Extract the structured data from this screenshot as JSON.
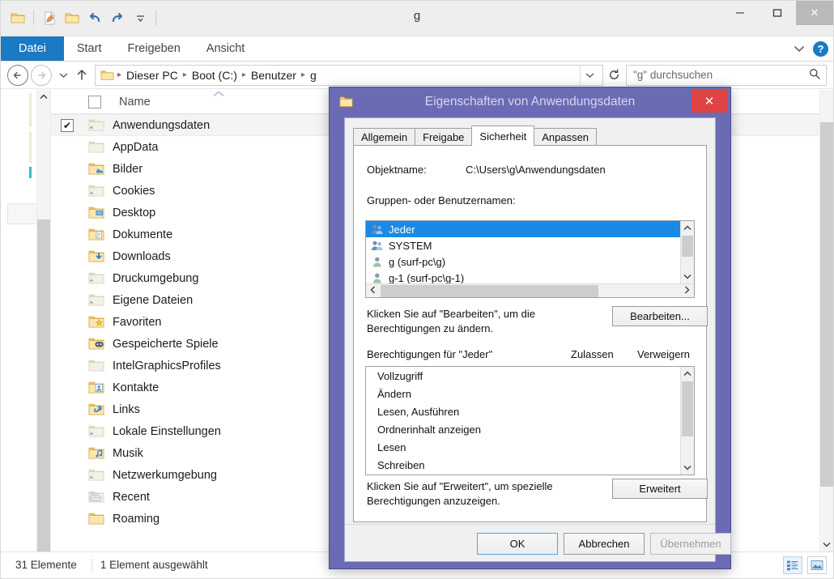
{
  "window": {
    "title": "g",
    "minimize_label": "–",
    "maximize_label": "❑",
    "close_label": "✕"
  },
  "quick_access": {
    "items": [
      {
        "name": "folder-icon",
        "label": ""
      },
      {
        "name": "new-document-icon",
        "label": ""
      },
      {
        "name": "new-folder-icon",
        "label": ""
      },
      {
        "name": "undo-icon",
        "label": "↶"
      },
      {
        "name": "redo-icon",
        "label": "↷"
      },
      {
        "name": "customize-qat-icon",
        "label": "▾"
      }
    ]
  },
  "ribbon": {
    "tabs": [
      {
        "label": "Datei",
        "active": true
      },
      {
        "label": "Start",
        "active": false
      },
      {
        "label": "Freigeben",
        "active": false
      },
      {
        "label": "Ansicht",
        "active": false
      }
    ],
    "expand_icon": "⌄",
    "help_icon": "?"
  },
  "address": {
    "back_icon": "←",
    "forward_icon": "→",
    "recent_icon": "▾",
    "up_icon": "↑",
    "breadcrumbs": [
      "Dieser PC",
      "Boot (C:)",
      "Benutzer",
      "g"
    ],
    "separator": "▸",
    "dropdown_icon": "⌄",
    "refresh_icon": "⟳",
    "search_placeholder": "\"g\" durchsuchen",
    "search_value": "",
    "search_icon": "⚲"
  },
  "column_header": {
    "name_label": "Name",
    "sort_indicator": "▴"
  },
  "file_list": {
    "items": [
      {
        "label": "Anwendungsdaten",
        "icon": "folder-junction-icon",
        "selected": true,
        "checked": true,
        "style": "pale"
      },
      {
        "label": "AppData",
        "icon": "folder-icon",
        "selected": false,
        "checked": false,
        "style": "pale"
      },
      {
        "label": "Bilder",
        "icon": "folder-pictures-icon",
        "selected": false,
        "checked": false,
        "style": "normal"
      },
      {
        "label": "Cookies",
        "icon": "folder-junction-icon",
        "selected": false,
        "checked": false,
        "style": "pale"
      },
      {
        "label": "Desktop",
        "icon": "folder-desktop-icon",
        "selected": false,
        "checked": false,
        "style": "normal"
      },
      {
        "label": "Dokumente",
        "icon": "folder-documents-icon",
        "selected": false,
        "checked": false,
        "style": "normal"
      },
      {
        "label": "Downloads",
        "icon": "folder-downloads-icon",
        "selected": false,
        "checked": false,
        "style": "normal"
      },
      {
        "label": "Druckumgebung",
        "icon": "folder-junction-icon",
        "selected": false,
        "checked": false,
        "style": "pale"
      },
      {
        "label": "Eigene Dateien",
        "icon": "folder-junction-icon",
        "selected": false,
        "checked": false,
        "style": "pale"
      },
      {
        "label": "Favoriten",
        "icon": "folder-favorites-icon",
        "selected": false,
        "checked": false,
        "style": "normal"
      },
      {
        "label": "Gespeicherte Spiele",
        "icon": "folder-savedgames-icon",
        "selected": false,
        "checked": false,
        "style": "normal"
      },
      {
        "label": "IntelGraphicsProfiles",
        "icon": "folder-icon",
        "selected": false,
        "checked": false,
        "style": "pale"
      },
      {
        "label": "Kontakte",
        "icon": "folder-contacts-icon",
        "selected": false,
        "checked": false,
        "style": "normal"
      },
      {
        "label": "Links",
        "icon": "folder-links-icon",
        "selected": false,
        "checked": false,
        "style": "normal"
      },
      {
        "label": "Lokale Einstellungen",
        "icon": "folder-junction-icon",
        "selected": false,
        "checked": false,
        "style": "pale"
      },
      {
        "label": "Musik",
        "icon": "folder-music-icon",
        "selected": false,
        "checked": false,
        "style": "normal"
      },
      {
        "label": "Netzwerkumgebung",
        "icon": "folder-junction-icon",
        "selected": false,
        "checked": false,
        "style": "pale"
      },
      {
        "label": "Recent",
        "icon": "folder-recent-icon",
        "selected": false,
        "checked": false,
        "style": "pale"
      },
      {
        "label": "Roaming",
        "icon": "folder-icon",
        "selected": false,
        "checked": false,
        "style": "normal"
      }
    ]
  },
  "status_bar": {
    "item_count": "31 Elemente",
    "selection": "1 Element ausgewählt",
    "view_details_icon": "details-view-icon",
    "view_thumbs_icon": "thumbnail-view-icon"
  },
  "dialog": {
    "title": "Eigenschaften von Anwendungsdaten",
    "icon": "folder-icon",
    "close_label": "✕",
    "tabs": [
      {
        "label": "Allgemein",
        "active": false
      },
      {
        "label": "Freigabe",
        "active": false
      },
      {
        "label": "Sicherheit",
        "active": true
      },
      {
        "label": "Anpassen",
        "active": false
      }
    ],
    "object_name_label": "Objektname:",
    "object_name_value": "C:\\Users\\g\\Anwendungsdaten",
    "groups_label": "Gruppen- oder Benutzernamen:",
    "groups": [
      {
        "label": "Jeder",
        "icon": "group-icon",
        "selected": true
      },
      {
        "label": "SYSTEM",
        "icon": "group-icon",
        "selected": false
      },
      {
        "label": "g (surf-pc\\g)",
        "icon": "user-icon",
        "selected": false
      },
      {
        "label": "g-1 (surf-pc\\g-1)",
        "icon": "user-icon",
        "selected": false
      }
    ],
    "edit_hint_line1": "Klicken Sie auf \"Bearbeiten\", um die",
    "edit_hint_line2": "Berechtigungen zu ändern.",
    "edit_button": "Bearbeiten...",
    "permissions_label": "Berechtigungen für \"Jeder\"",
    "col_allow": "Zulassen",
    "col_deny": "Verweigern",
    "permissions": [
      "Vollzugriff",
      "Ändern",
      "Lesen, Ausführen",
      "Ordnerinhalt anzeigen",
      "Lesen",
      "Schreiben"
    ],
    "advanced_hint_line1": "Klicken Sie auf \"Erweitert\", um spezielle",
    "advanced_hint_line2": "Berechtigungen anzuzeigen.",
    "advanced_button": "Erweitert",
    "ok_button": "OK",
    "cancel_button": "Abbrechen",
    "apply_button": "Übernehmen",
    "scroll_up_icon": "⌃",
    "scroll_down_icon": "⌄",
    "scroll_left_icon": "‹",
    "scroll_right_icon": "›"
  },
  "colors": {
    "ribbon_accent": "#1a7ac4",
    "dialog_frame": "#6b6bb5",
    "close_red": "#e04343",
    "selection_blue": "#1a8ae5"
  }
}
